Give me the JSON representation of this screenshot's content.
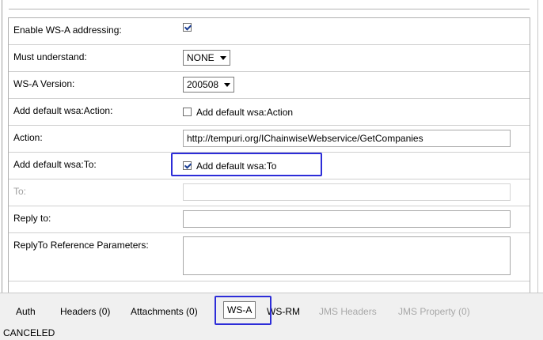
{
  "form": {
    "rows": [
      {
        "label": "Enable WS-A addressing:",
        "checked": true
      },
      {
        "label": "Must understand:",
        "value": "NONE"
      },
      {
        "label": "WS-A Version:",
        "value": "200508"
      },
      {
        "label": "Add default wsa:Action:",
        "checkbox_label": "Add default wsa:Action",
        "checked": false
      },
      {
        "label": "Action:",
        "value": "http://tempuri.org/IChainwiseWebservice/GetCompanies"
      },
      {
        "label": "Add default wsa:To:",
        "checkbox_label": "Add default wsa:To",
        "checked": true
      },
      {
        "label": "To:",
        "value": ""
      },
      {
        "label": "Reply to:",
        "value": ""
      },
      {
        "label": "ReplyTo Reference Parameters:",
        "value": ""
      }
    ]
  },
  "tabs": [
    {
      "label": "Auth",
      "state": "normal"
    },
    {
      "label": "Headers (0)",
      "state": "normal"
    },
    {
      "label": "Attachments (0)",
      "state": "normal"
    },
    {
      "label": "WS-A",
      "state": "active"
    },
    {
      "label": "WS-RM",
      "state": "normal"
    },
    {
      "label": "JMS Headers",
      "state": "disabled"
    },
    {
      "label": "JMS Property (0)",
      "state": "disabled"
    }
  ],
  "status": {
    "text": "CANCELED"
  },
  "colors": {
    "highlight": "#2d2dd8",
    "checkmark": "#1c3f94",
    "disabled_text": "#a0a0a0"
  }
}
